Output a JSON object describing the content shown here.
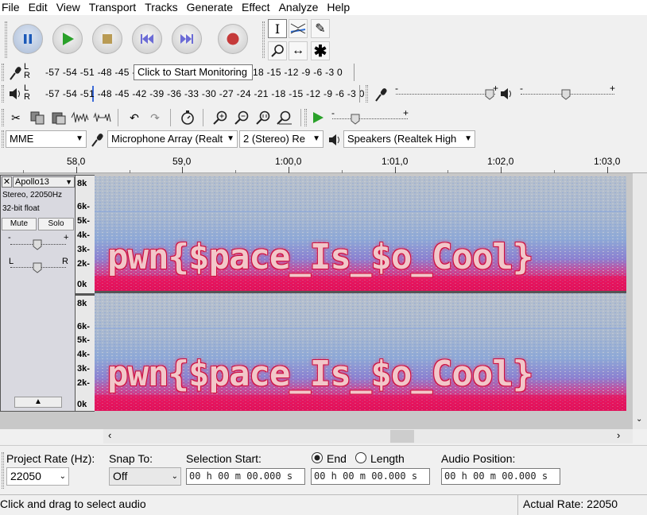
{
  "menu": [
    "File",
    "Edit",
    "View",
    "Transport",
    "Tracks",
    "Generate",
    "Effect",
    "Analyze",
    "Help"
  ],
  "transport": {
    "pause": "pause-icon",
    "play": "play-icon",
    "stop": "stop-icon",
    "skip_start": "skip-start-icon",
    "skip_end": "skip-end-icon",
    "record": "record-icon"
  },
  "meters": {
    "record_scale": "-57 -54 -51 -48 -45 -42",
    "record_scale_tail": "18 -15 -12  -9  -6  -3  0",
    "monitor_tooltip": "Click to Start Monitoring",
    "play_scale": "-57 -54 -51 -48 -45 -42 -39 -36 -33 -30 -27 -24 -21 -18 -15 -12  -9  -6  -3  0",
    "L": "L",
    "R": "R"
  },
  "device": {
    "host": "MME",
    "mic": "Microphone Array (Realt",
    "channels": "2 (Stereo) Re",
    "speaker": "Speakers (Realtek High"
  },
  "ruler": [
    "58,0",
    "59,0",
    "1:00,0",
    "1:01,0",
    "1:02,0",
    "1:03,0"
  ],
  "track": {
    "name": "Apollo13",
    "format": "Stereo, 22050Hz",
    "bits": "32-bit float",
    "mute": "Mute",
    "solo": "Solo",
    "gain_minus": "-",
    "gain_plus": "+",
    "pan_l": "L",
    "pan_r": "R",
    "freq_labels": [
      "8k",
      "6k-",
      "5k-",
      "4k-",
      "3k-",
      "2k-",
      "0k"
    ],
    "flag": "pwn{$pace_Is_$o_Cool}"
  },
  "selection": {
    "project_rate_label": "Project Rate (Hz):",
    "project_rate": "22050",
    "snap_label": "Snap To:",
    "snap_value": "Off",
    "sel_start_label": "Selection Start:",
    "end_label": "End",
    "length_label": "Length",
    "audio_pos_label": "Audio Position:",
    "time_value": "00 h 00 m 00.000 s"
  },
  "status": {
    "hint": "Click and drag to select audio",
    "actual_rate": "Actual Rate: 22050"
  },
  "colors": {
    "spectrogram_bg": "#a9b9cf",
    "spectrogram_high": "#e3155a",
    "flag_fill": "#f2c7c9"
  }
}
